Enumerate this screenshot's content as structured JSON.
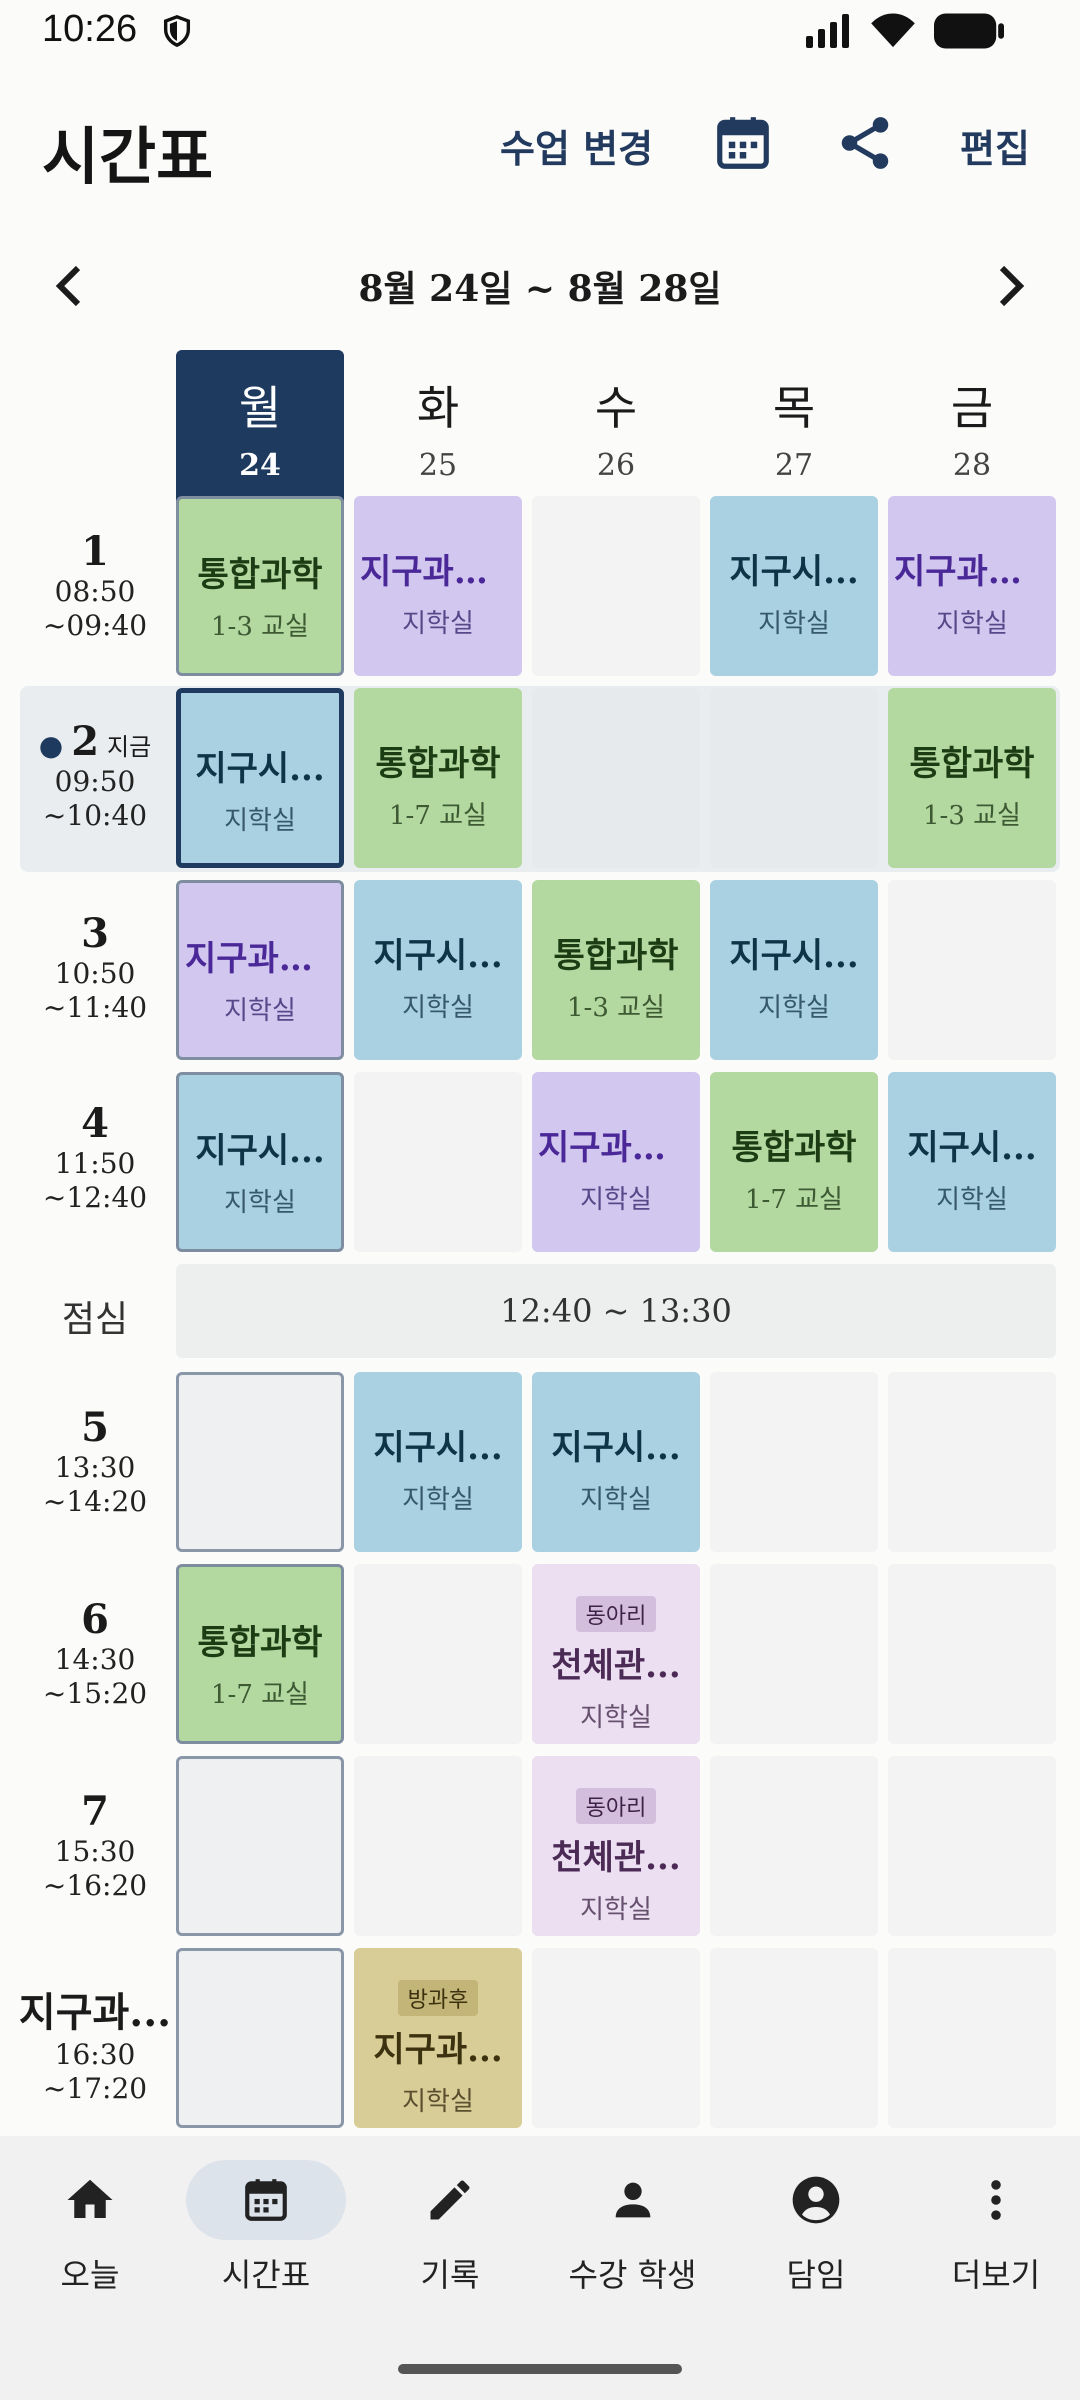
{
  "status_bar": {
    "time": "10:26"
  },
  "app_bar": {
    "title": "시간표",
    "change_class_label": "수업 변경",
    "edit_label": "편집"
  },
  "week": {
    "range": "8월 24일 ~ 8월 28일"
  },
  "days": [
    {
      "name": "월",
      "date": "24",
      "today": true
    },
    {
      "name": "화",
      "date": "25"
    },
    {
      "name": "수",
      "date": "26"
    },
    {
      "name": "목",
      "date": "27"
    },
    {
      "name": "금",
      "date": "28"
    }
  ],
  "periods": [
    {
      "num": "1",
      "start": "08:50",
      "end": "~09:40"
    },
    {
      "num": "2",
      "now": "지금",
      "start": "09:50",
      "end": "~10:40"
    },
    {
      "num": "3",
      "start": "10:50",
      "end": "~11:40"
    },
    {
      "num": "4",
      "start": "11:50",
      "end": "~12:40"
    },
    {
      "num": "5",
      "start": "13:30",
      "end": "~14:20"
    },
    {
      "num": "6",
      "start": "14:30",
      "end": "~15:20"
    },
    {
      "num": "7",
      "start": "15:30",
      "end": "~16:20"
    },
    {
      "name": "지구과...",
      "start": "16:30",
      "end": "~17:20"
    }
  ],
  "lunch": {
    "label": "점심",
    "time": "12:40 ~ 13:30"
  },
  "timetable": {
    "p1": [
      {
        "subject": "통합과학",
        "room": "1-3 교실"
      },
      {
        "subject": "지구과학II",
        "room": "지학실"
      },
      null,
      {
        "subject": "지구시...",
        "room": "지학실"
      },
      {
        "subject": "지구과학II",
        "room": "지학실"
      }
    ],
    "p2": [
      {
        "subject": "지구시...",
        "room": "지학실"
      },
      {
        "subject": "통합과학",
        "room": "1-7 교실"
      },
      null,
      null,
      {
        "subject": "통합과학",
        "room": "1-3 교실"
      }
    ],
    "p3": [
      {
        "subject": "지구과학II",
        "room": "지학실"
      },
      {
        "subject": "지구시...",
        "room": "지학실"
      },
      {
        "subject": "통합과학",
        "room": "1-3 교실"
      },
      {
        "subject": "지구시...",
        "room": "지학실"
      },
      null
    ],
    "p4": [
      {
        "subject": "지구시...",
        "room": "지학실"
      },
      null,
      {
        "subject": "지구과학II",
        "room": "지학실"
      },
      {
        "subject": "통합과학",
        "room": "1-7 교실"
      },
      {
        "subject": "지구시...",
        "room": "지학실"
      }
    ],
    "p5": [
      null,
      {
        "subject": "지구시...",
        "room": "지학실"
      },
      {
        "subject": "지구시...",
        "room": "지학실"
      },
      null,
      null
    ],
    "p6": [
      {
        "subject": "통합과학",
        "room": "1-7 교실"
      },
      null,
      {
        "tag": "동아리",
        "subject": "천체관...",
        "room": "지학실"
      },
      null,
      null
    ],
    "p7": [
      null,
      null,
      {
        "tag": "동아리",
        "subject": "천체관...",
        "room": "지학실"
      },
      null,
      null
    ],
    "p8": [
      null,
      {
        "tag": "방과후",
        "subject": "지구과...",
        "room": "지학실"
      },
      null,
      null,
      null
    ]
  },
  "bottom_nav": [
    {
      "label": "오늘",
      "icon": "home-icon"
    },
    {
      "label": "시간표",
      "icon": "calendar-icon",
      "active": true
    },
    {
      "label": "기록",
      "icon": "pencil-icon"
    },
    {
      "label": "수강 학생",
      "icon": "person-icon"
    },
    {
      "label": "담임",
      "icon": "account-circle-icon"
    },
    {
      "label": "더보기",
      "icon": "more-vert-icon"
    }
  ],
  "colors": {
    "accent": "#1e3a5f",
    "integrated_science": "#b3d8a0",
    "earth_systems": "#a9d1e2",
    "earth_science_2": "#d2c7ef",
    "club": "#ecdff2",
    "after_school": "#d9cd97"
  }
}
